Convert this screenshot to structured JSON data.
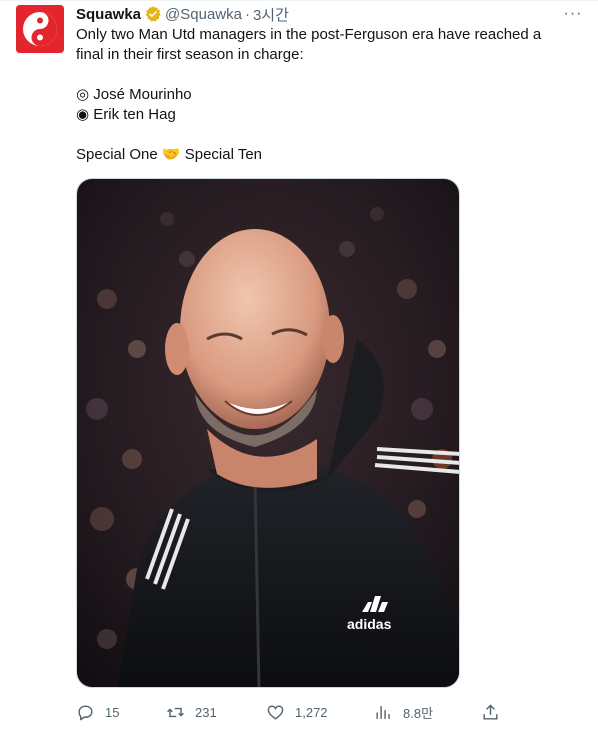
{
  "tweet": {
    "display_name": "Squawka",
    "handle": "@Squawka",
    "separator": "·",
    "time": "3시간",
    "lines": [
      "Only two Man Utd managers in the post-Ferguson era have reached a",
      "final in their first season in charge:",
      "",
      "◎ José Mourinho",
      "◉ Erik ten Hag",
      "",
      "Special One 🤝 Special Ten"
    ],
    "more_label": "···"
  },
  "image": {
    "logo_text": "adidas"
  },
  "actions": {
    "replies": "15",
    "retweets": "231",
    "likes": "1,272",
    "views": "8.8만"
  },
  "colors": {
    "brand_red": "#e3262d",
    "verified_gold": "#e2b719",
    "muted": "#536471",
    "text": "#0f1419"
  },
  "icons": [
    "verified-badge-icon",
    "more-icon",
    "reply-icon",
    "retweet-icon",
    "like-icon",
    "views-icon",
    "share-icon"
  ]
}
